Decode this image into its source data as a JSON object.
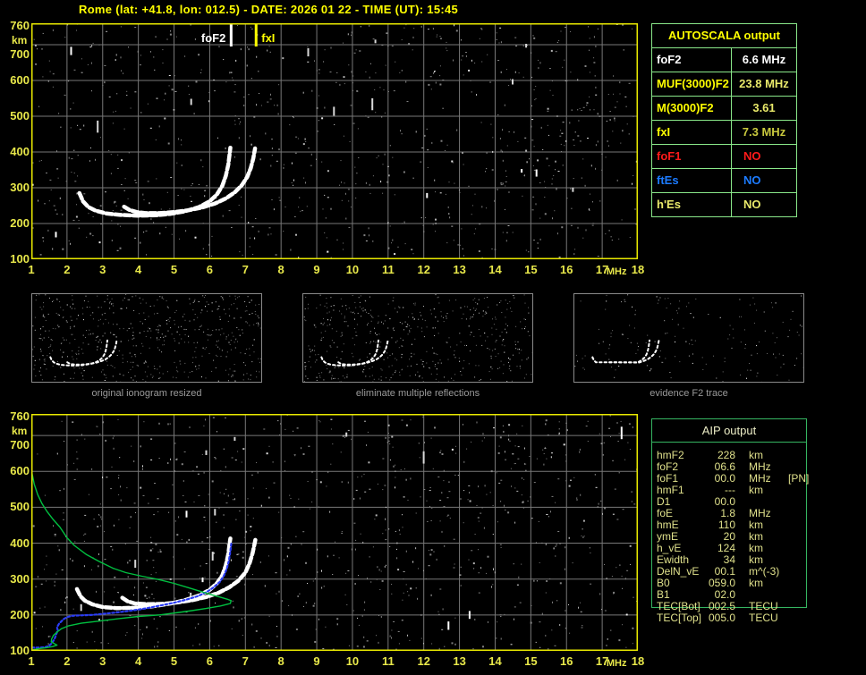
{
  "title": "Rome (lat: +41.8, lon: 012.5) - DATE: 2026 01 22 - TIME (UT): 15:45",
  "autoscala_table": {
    "header": "AUTOSCALA output",
    "rows": [
      {
        "label": "foF2",
        "value": "6.6 MHz",
        "label_color": "#ffffff",
        "value_color": "#ffffff",
        "value_align": "center"
      },
      {
        "label": "MUF(3000)F2",
        "value": "23.8 MHz",
        "label_color": "#ffff00",
        "value_color": "#e9e96a",
        "value_align": "center"
      },
      {
        "label": "M(3000)F2",
        "value": "3.61",
        "label_color": "#ffff00",
        "value_color": "#e9e96a",
        "value_align": "center"
      },
      {
        "label": "fxI",
        "value": "7.3 MHz",
        "label_color": "#ffff00",
        "value_color": "#c9c93e",
        "value_align": "center"
      },
      {
        "label": "foF1",
        "value": "NO",
        "label_color": "#ff1a1a",
        "value_color": "#ff1a1a",
        "value_align": "left"
      },
      {
        "label": "ftEs",
        "value": "NO",
        "label_color": "#1c7bff",
        "value_color": "#1c7bff",
        "value_align": "left"
      },
      {
        "label": "h'Es",
        "value": "NO",
        "label_color": "#e9e96a",
        "value_color": "#e9e96a",
        "value_align": "left"
      }
    ]
  },
  "aip_table": {
    "header": "AIP output",
    "rows": [
      {
        "label": "hmF2",
        "value": "228",
        "unit": "km",
        "extra": ""
      },
      {
        "label": "foF2",
        "value": "06.6",
        "unit": "MHz",
        "extra": ""
      },
      {
        "label": "foF1",
        "value": "00.0",
        "unit": "MHz",
        "extra": "[PN]"
      },
      {
        "label": "hmF1",
        "value": "---",
        "unit": "km",
        "extra": ""
      },
      {
        "label": "D1",
        "value": "00.0",
        "unit": "",
        "extra": ""
      },
      {
        "label": "foE",
        "value": "1.8",
        "unit": "MHz",
        "extra": ""
      },
      {
        "label": "hmE",
        "value": "110",
        "unit": "km",
        "extra": ""
      },
      {
        "label": "ymE",
        "value": "20",
        "unit": "km",
        "extra": ""
      },
      {
        "label": "h_vE",
        "value": "124",
        "unit": "km",
        "extra": ""
      },
      {
        "label": "Ewidth",
        "value": "34",
        "unit": "km",
        "extra": ""
      },
      {
        "label": "DelN_vE",
        "value": "00.1",
        "unit": "m^(-3)",
        "extra": ""
      },
      {
        "label": "B0",
        "value": "059.0",
        "unit": "km",
        "extra": ""
      },
      {
        "label": "B1",
        "value": "02.0",
        "unit": "",
        "extra": ""
      },
      {
        "label": "TEC[Bot]",
        "value": "002.5",
        "unit": "TECU",
        "extra": ""
      },
      {
        "label": "TEC[Top]",
        "value": "005.0",
        "unit": "TECU",
        "extra": ""
      }
    ]
  },
  "thumbnails": [
    {
      "caption": "original ionogram resized"
    },
    {
      "caption": "eliminate multiple reflections"
    },
    {
      "caption": "evidence F2 trace"
    }
  ],
  "chart_data": [
    {
      "type": "scatter",
      "title": "scaled ionogram with foF2 / fxI markers",
      "xlabel": "MHz",
      "ylabel": "km",
      "xlim": [
        1,
        18
      ],
      "ylim": [
        100,
        760
      ],
      "x_ticks": [
        1,
        2,
        3,
        4,
        5,
        6,
        7,
        8,
        9,
        10,
        11,
        12,
        13,
        14,
        15,
        16,
        17,
        18
      ],
      "y_ticks": [
        760,
        700,
        600,
        500,
        400,
        300,
        200,
        100
      ],
      "grid": true,
      "legend_position": "none",
      "markers": [
        {
          "name": "foF2",
          "freq": 6.6,
          "color": "#ffffff",
          "side": "left"
        },
        {
          "name": "fxI",
          "freq": 7.3,
          "color": "#ffff00",
          "side": "right"
        }
      ],
      "series": [
        {
          "name": "O-trace",
          "color": "#ffffff",
          "points": [
            [
              2.35,
              285
            ],
            [
              2.45,
              262
            ],
            [
              2.6,
              246
            ],
            [
              2.8,
              236
            ],
            [
              3.1,
              228
            ],
            [
              3.5,
              224
            ],
            [
              4.0,
              222
            ],
            [
              4.5,
              223
            ],
            [
              4.9,
              227
            ],
            [
              5.3,
              234
            ],
            [
              5.7,
              246
            ],
            [
              6.0,
              262
            ],
            [
              6.2,
              281
            ],
            [
              6.35,
              305
            ],
            [
              6.45,
              333
            ],
            [
              6.52,
              365
            ],
            [
              6.56,
              395
            ],
            [
              6.58,
              412
            ]
          ]
        },
        {
          "name": "X-trace",
          "color": "#ffffff",
          "points": [
            [
              3.6,
              247
            ],
            [
              3.75,
              238
            ],
            [
              3.95,
              232
            ],
            [
              4.2,
              229
            ],
            [
              4.6,
              229
            ],
            [
              5.0,
              232
            ],
            [
              5.4,
              237
            ],
            [
              5.8,
              245
            ],
            [
              6.15,
              256
            ],
            [
              6.45,
              270
            ],
            [
              6.7,
              287
            ],
            [
              6.9,
              307
            ],
            [
              7.05,
              330
            ],
            [
              7.15,
              355
            ],
            [
              7.22,
              382
            ],
            [
              7.27,
              410
            ]
          ]
        }
      ]
    },
    {
      "type": "scatter",
      "title": "ionogram with restored trace and electron density profile",
      "xlabel": "MHz",
      "ylabel": "km",
      "xlim": [
        1,
        18
      ],
      "ylim": [
        100,
        760
      ],
      "x_ticks": [
        1,
        2,
        3,
        4,
        5,
        6,
        7,
        8,
        9,
        10,
        11,
        12,
        13,
        14,
        15,
        16,
        17,
        18
      ],
      "y_ticks": [
        760,
        700,
        600,
        500,
        400,
        300,
        200,
        100
      ],
      "grid": true,
      "legend_position": "none",
      "markers": [],
      "series": [
        {
          "name": "O-trace",
          "color": "#ffffff",
          "points": [
            [
              2.28,
              272
            ],
            [
              2.38,
              252
            ],
            [
              2.5,
              240
            ],
            [
              2.7,
              230
            ],
            [
              3.0,
              222
            ],
            [
              3.4,
              219
            ],
            [
              3.9,
              220
            ],
            [
              4.4,
              224
            ],
            [
              4.9,
              232
            ],
            [
              5.3,
              241
            ],
            [
              5.7,
              254
            ],
            [
              6.0,
              270
            ],
            [
              6.2,
              288
            ],
            [
              6.35,
              310
            ],
            [
              6.45,
              338
            ],
            [
              6.52,
              370
            ],
            [
              6.56,
              400
            ],
            [
              6.58,
              413
            ]
          ]
        },
        {
          "name": "X-trace",
          "color": "#ffffff",
          "points": [
            [
              3.55,
              248
            ],
            [
              3.7,
              238
            ],
            [
              3.9,
              232
            ],
            [
              4.3,
              230
            ],
            [
              4.7,
              231
            ],
            [
              5.1,
              235
            ],
            [
              5.5,
              241
            ],
            [
              5.9,
              250
            ],
            [
              6.25,
              262
            ],
            [
              6.55,
              277
            ],
            [
              6.8,
              295
            ],
            [
              7.0,
              318
            ],
            [
              7.12,
              345
            ],
            [
              7.2,
              372
            ],
            [
              7.26,
              400
            ],
            [
              7.29,
              415
            ]
          ]
        },
        {
          "name": "restored-trace",
          "color": "#2a3cf5",
          "points": [
            [
              1.02,
              109
            ],
            [
              1.2,
              109
            ],
            [
              1.38,
              110
            ],
            [
              1.5,
              114
            ],
            [
              1.58,
              122
            ],
            [
              1.65,
              133
            ],
            [
              1.7,
              146
            ],
            [
              1.74,
              158
            ],
            [
              1.72,
              166
            ],
            [
              1.78,
              176
            ],
            [
              1.9,
              188
            ],
            [
              2.0,
              194
            ],
            [
              2.15,
              198
            ],
            [
              2.4,
              199
            ],
            [
              2.7,
              200
            ],
            [
              3.0,
              203
            ],
            [
              3.4,
              207
            ],
            [
              3.8,
              212
            ],
            [
              4.2,
              218
            ],
            [
              4.6,
              226
            ],
            [
              5.0,
              234
            ],
            [
              5.35,
              243
            ],
            [
              5.65,
              252
            ],
            [
              5.9,
              263
            ],
            [
              6.1,
              276
            ],
            [
              6.28,
              292
            ],
            [
              6.4,
              310
            ],
            [
              6.48,
              330
            ],
            [
              6.54,
              352
            ],
            [
              6.58,
              378
            ],
            [
              6.61,
              403
            ]
          ]
        },
        {
          "name": "density-profile",
          "color": "#00c040",
          "points": [
            [
              1.01,
              600
            ],
            [
              1.08,
              565
            ],
            [
              1.18,
              535
            ],
            [
              1.3,
              510
            ],
            [
              1.45,
              487
            ],
            [
              1.62,
              465
            ],
            [
              1.8,
              445
            ],
            [
              2.0,
              415
            ],
            [
              2.2,
              394
            ],
            [
              2.55,
              368
            ],
            [
              2.9,
              349
            ],
            [
              3.3,
              330
            ],
            [
              3.65,
              318
            ],
            [
              4.1,
              308
            ],
            [
              4.55,
              299
            ],
            [
              5.0,
              288
            ],
            [
              5.4,
              276
            ],
            [
              5.8,
              264
            ],
            [
              6.1,
              255
            ],
            [
              6.35,
              248
            ],
            [
              6.52,
              243
            ],
            [
              6.6,
              240
            ],
            [
              6.58,
              232
            ],
            [
              6.3,
              225
            ],
            [
              5.9,
              218
            ],
            [
              5.5,
              212
            ],
            [
              5.14,
              207
            ],
            [
              4.6,
              200
            ],
            [
              4.0,
              196
            ],
            [
              3.46,
              190
            ],
            [
              2.9,
              183
            ],
            [
              2.4,
              177
            ],
            [
              2.05,
              170
            ],
            [
              1.85,
              162
            ],
            [
              1.73,
              153
            ],
            [
              1.62,
              143
            ],
            [
              1.57,
              133
            ],
            [
              1.56,
              125
            ],
            [
              1.65,
              120
            ],
            [
              1.72,
              116
            ],
            [
              1.6,
              112
            ],
            [
              1.42,
              109
            ],
            [
              1.2,
              106
            ],
            [
              1.05,
              103
            ]
          ]
        }
      ]
    }
  ]
}
